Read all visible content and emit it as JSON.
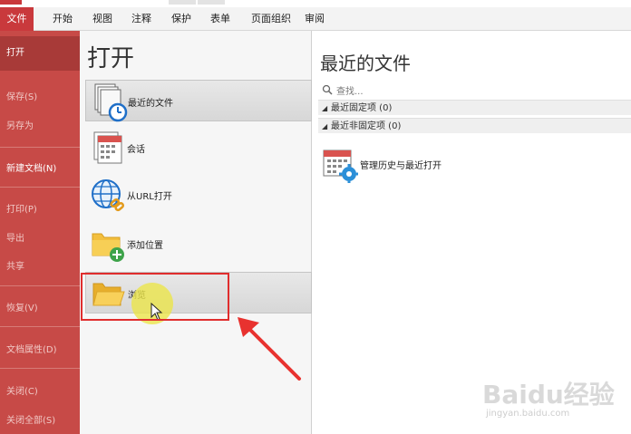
{
  "menubar": {
    "tabs": [
      {
        "label": "文件",
        "active": true
      },
      {
        "label": "开始"
      },
      {
        "label": "视图"
      },
      {
        "label": "注释"
      },
      {
        "label": "保护"
      },
      {
        "label": "表单"
      },
      {
        "label": "页面组织"
      },
      {
        "label": "审阅"
      }
    ]
  },
  "sidebar": {
    "items": [
      {
        "label": "打开"
      },
      {
        "label": "保存(S)"
      },
      {
        "label": "另存为"
      },
      {
        "label": "新建文档(N)"
      },
      {
        "label": "打印(P)"
      },
      {
        "label": "导出"
      },
      {
        "label": "共享"
      },
      {
        "label": "恢复(V)"
      },
      {
        "label": "文档属性(D)"
      },
      {
        "label": "关闭(C)"
      },
      {
        "label": "关闭全部(S)"
      }
    ]
  },
  "open_panel": {
    "title": "打开",
    "options": [
      {
        "label": "最近的文件",
        "icon": "recent-files-clock-icon"
      },
      {
        "label": "会话",
        "icon": "session-calendar-icon"
      },
      {
        "label": "从URL打开",
        "icon": "globe-link-icon"
      },
      {
        "label": "添加位置",
        "icon": "folder-add-icon"
      },
      {
        "label": "浏览",
        "icon": "folder-open-icon"
      }
    ]
  },
  "recent_panel": {
    "title": "最近的文件",
    "search_placeholder": "查找...",
    "groups": [
      {
        "label": "最近固定项 (0)"
      },
      {
        "label": "最近非固定项 (0)"
      }
    ],
    "manage_label": "管理历史与最近打开"
  },
  "watermark": {
    "brand": "Baidu经验",
    "url": "jingyan.baidu.com"
  },
  "colors": {
    "accent": "#c9393c",
    "sidebar": "#c74a47",
    "highlight": "#e02d2d"
  }
}
